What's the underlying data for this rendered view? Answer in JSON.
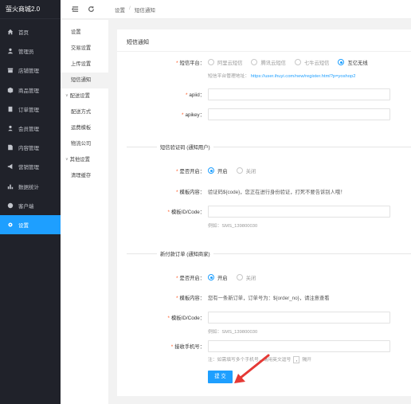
{
  "app": {
    "brand": "萤火商城2.0"
  },
  "sidebar": {
    "items": [
      {
        "label": "首页",
        "icon": "home-icon"
      },
      {
        "label": "管理员",
        "icon": "user-icon"
      },
      {
        "label": "店铺管理",
        "icon": "store-icon"
      },
      {
        "label": "商品管理",
        "icon": "goods-icon"
      },
      {
        "label": "订单管理",
        "icon": "order-icon"
      },
      {
        "label": "会员管理",
        "icon": "member-icon"
      },
      {
        "label": "内容管理",
        "icon": "content-icon"
      },
      {
        "label": "营销管理",
        "icon": "marketing-icon"
      },
      {
        "label": "数据统计",
        "icon": "chart-icon"
      },
      {
        "label": "客户端",
        "icon": "client-icon"
      },
      {
        "label": "设置",
        "icon": "gear-icon"
      }
    ],
    "active_index": 10
  },
  "topbar": {
    "crumbs": [
      "设置",
      "/",
      "短信通知"
    ]
  },
  "submenu": {
    "items": [
      {
        "label": "设置",
        "type": "item"
      },
      {
        "label": "交易设置",
        "type": "item"
      },
      {
        "label": "上传设置",
        "type": "item"
      },
      {
        "label": "短信通知",
        "type": "item",
        "active": true
      },
      {
        "label": "配送设置",
        "type": "group"
      },
      {
        "label": "配送方式",
        "type": "item"
      },
      {
        "label": "运费模板",
        "type": "item"
      },
      {
        "label": "物流公司",
        "type": "item"
      },
      {
        "label": "其他设置",
        "type": "group"
      },
      {
        "label": "清理缓存",
        "type": "item"
      }
    ]
  },
  "form": {
    "title": "短信通知",
    "platform": {
      "label": "短信平台：",
      "options": [
        "阿里云短信",
        "腾讯云短信",
        "七牛云短信",
        "互亿无线"
      ],
      "selected": 3,
      "hint_prefix": "短信平台管理地址：",
      "hint_link": "https://user.ihuyi.com/new/register.html?p=yoshop2"
    },
    "apiid": {
      "label": "apiid：",
      "value": ""
    },
    "apikey": {
      "label": "apikey：",
      "value": ""
    },
    "section1": "短信验证码 (通知用户)",
    "s1_enable": {
      "label": "是否开启：",
      "on": "开启",
      "off": "关闭"
    },
    "s1_template": {
      "label": "模板内容：",
      "value": "验证码${code}，您正在进行身份验证，打死不要告诉别人哦！"
    },
    "s1_code": {
      "label": "模板ID/Code：",
      "value": "",
      "hint": "例如：SMS_139800030"
    },
    "section2": "新付款订单 (通知商家)",
    "s2_enable": {
      "label": "是否开启：",
      "on": "开启",
      "off": "关闭"
    },
    "s2_template": {
      "label": "模板内容：",
      "value": "您有一条新订单，订单号为：${order_no}，请注意查看"
    },
    "s2_code": {
      "label": "模板ID/Code：",
      "value": "",
      "hint": "例如：SMS_139800030"
    },
    "s2_phone": {
      "label": "接收手机号：",
      "value": "",
      "hint_prefix": "注：如需填写多个手机号，请用英文逗号",
      "hint_comma": ",",
      "hint_suffix": "隔开"
    },
    "submit": "提 交"
  },
  "colors": {
    "accent": "#1e9fff",
    "sidebar_bg": "#20222a",
    "required": "#ff5722",
    "arrow": "#e53935"
  }
}
